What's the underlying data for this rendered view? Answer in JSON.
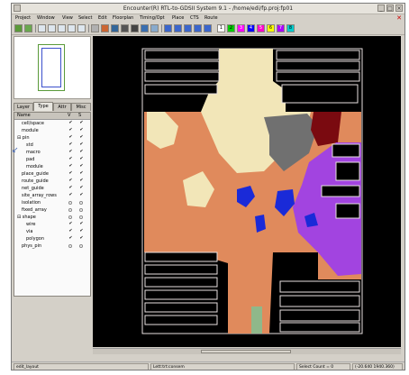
{
  "window": {
    "title": "Encounter(R) RTL-to-GDSII System 9.1 - /home/edi/fp.proj:fp01"
  },
  "menu": [
    {
      "label": "Project"
    },
    {
      "label": "Window"
    },
    {
      "label": "View"
    },
    {
      "label": "Select"
    },
    {
      "label": "Edit"
    },
    {
      "label": "Floorplan"
    },
    {
      "label": "Timing/Opt"
    },
    {
      "label": "Place"
    },
    {
      "label": "CTS"
    },
    {
      "label": "Route"
    }
  ],
  "toolbar": {
    "buttons": [
      {
        "icon": "open-icon",
        "color": "#5a9a3a"
      },
      {
        "icon": "save-icon",
        "color": "#6aa84f"
      },
      {
        "icon": "zoom-in-icon",
        "color": "#dde6ee"
      },
      {
        "icon": "zoom-out-icon",
        "color": "#dde6ee"
      },
      {
        "icon": "zoom-fit-icon",
        "color": "#dde6ee"
      },
      {
        "icon": "zoom-select-icon",
        "color": "#dde6ee"
      },
      {
        "icon": "redraw-icon",
        "color": "#dde6ee"
      },
      {
        "icon": "ruler-icon",
        "color": "#b0b0b0"
      },
      {
        "icon": "place-icon",
        "color": "#cc6633"
      },
      {
        "icon": "route-icon",
        "color": "#336699"
      },
      {
        "icon": "wire-icon",
        "color": "#555555"
      },
      {
        "icon": "hier-icon",
        "color": "#444444"
      },
      {
        "icon": "map-icon",
        "color": "#3a6fb0"
      },
      {
        "icon": "window-icon",
        "color": "#88aacc"
      },
      {
        "icon": "back-icon",
        "color": "#3b66cc"
      },
      {
        "icon": "forward-icon",
        "color": "#3b66cc"
      },
      {
        "icon": "up-icon",
        "color": "#3b66cc"
      },
      {
        "icon": "down-icon",
        "color": "#3b66cc"
      },
      {
        "icon": "left-icon",
        "color": "#3b66cc"
      }
    ],
    "color_swatches": [
      "#ffffff",
      "#00cc00",
      "#ff00ff",
      "#0000ff",
      "#ff00cc",
      "#ffff00",
      "#aa00ff",
      "#00cccc"
    ],
    "swatch_numbers": [
      "1",
      "2",
      "3",
      "4",
      "5",
      "6",
      "7",
      "8"
    ]
  },
  "tabs": [
    {
      "label": "Layer"
    },
    {
      "label": "Type"
    },
    {
      "label": "Attr"
    },
    {
      "label": "Misc"
    }
  ],
  "list_header": {
    "name": "Name",
    "v": "V",
    "s": "S"
  },
  "layers": [
    {
      "label": "cell/space",
      "indent": 1,
      "kind": "check"
    },
    {
      "label": "module",
      "indent": 1,
      "kind": "check"
    },
    {
      "label": "⊟ pin",
      "indent": 0,
      "kind": "check"
    },
    {
      "label": "std",
      "indent": 2,
      "kind": "check"
    },
    {
      "label": "macro",
      "indent": 2,
      "kind": "check"
    },
    {
      "label": "pad",
      "indent": 2,
      "kind": "check"
    },
    {
      "label": "module",
      "indent": 2,
      "kind": "check"
    },
    {
      "label": "place_guide",
      "indent": 1,
      "kind": "check"
    },
    {
      "label": "route_guide",
      "indent": 1,
      "kind": "check"
    },
    {
      "label": "net_guide",
      "indent": 1,
      "kind": "check"
    },
    {
      "label": "site_array_rows",
      "indent": 1,
      "kind": "check"
    },
    {
      "label": "isolation",
      "indent": 1,
      "kind": "radio"
    },
    {
      "label": "fixed_array",
      "indent": 1,
      "kind": "radio"
    },
    {
      "label": "⊟ shape",
      "indent": 0,
      "kind": "radio"
    },
    {
      "label": "wire",
      "indent": 2,
      "kind": "check"
    },
    {
      "label": "via",
      "indent": 2,
      "kind": "check"
    },
    {
      "label": "polygon",
      "indent": 2,
      "kind": "check"
    },
    {
      "label": "phys_pin",
      "indent": 1,
      "kind": "radio"
    }
  ],
  "status": {
    "mode": "edit_layout",
    "layer": "Lett:trt:consem",
    "select": "Select Count = 0",
    "coords": "(-20.640 1940.360)"
  },
  "annotation": "↙",
  "colors": {
    "canvas": "#000000",
    "cell_yellow": "#f2e6b8",
    "cell_orange": "#e08a5c",
    "cell_purple": "#a244e0",
    "cell_gray": "#707070",
    "cell_darkred": "#7a0a10",
    "cell_blue": "#1a2ad8",
    "cell_green": "#8fb88a",
    "macro_outline": "#e8e0e0"
  }
}
